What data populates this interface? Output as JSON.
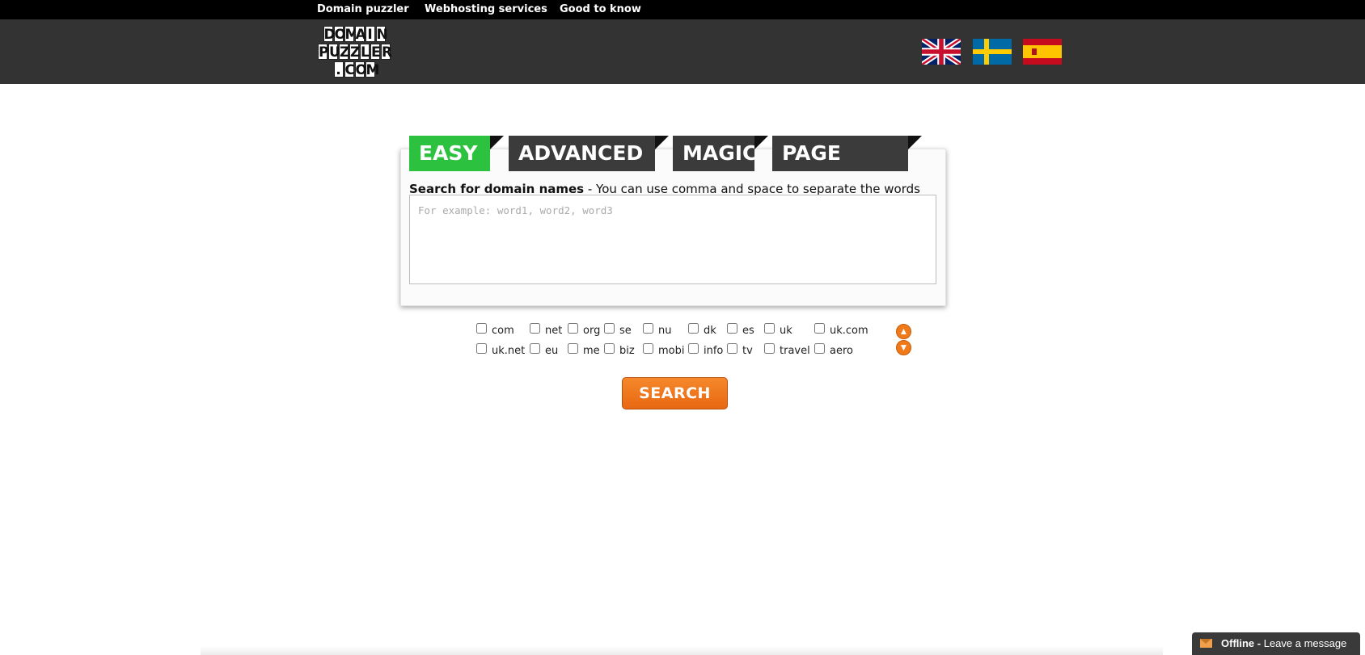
{
  "topnav": {
    "items": [
      "Domain puzzler",
      "Webhosting services",
      "Good to know"
    ]
  },
  "header": {
    "logo_rows": [
      "DOMAIN",
      "PUZZLER",
      ".COM"
    ],
    "flags": [
      "uk-flag-icon",
      "sweden-flag-icon",
      "spain-flag-icon"
    ]
  },
  "tabs": [
    "EASY",
    "ADVANCED",
    "MAGIC",
    "PAGE RANK"
  ],
  "search": {
    "label_bold": "Search for domain names",
    "label_rest": " - You can use comma and space to separate the words",
    "placeholder": "For example: word1, word2, word3",
    "value": ""
  },
  "tlds": {
    "row1": [
      "com",
      "net",
      "org",
      "se",
      "nu",
      "dk",
      "es",
      "uk",
      "uk.com"
    ],
    "row2": [
      "uk.net",
      "eu",
      "me",
      "biz",
      "mobi",
      "info",
      "tv",
      "travel",
      "aero"
    ]
  },
  "search_button": "SEARCH",
  "chat": {
    "status": "Offline -",
    "action": " Leave a message"
  },
  "colors": {
    "active_tab": "#2cc13f",
    "tab": "#3b3b3b",
    "accent": "#f07a1a",
    "header": "#333333"
  }
}
